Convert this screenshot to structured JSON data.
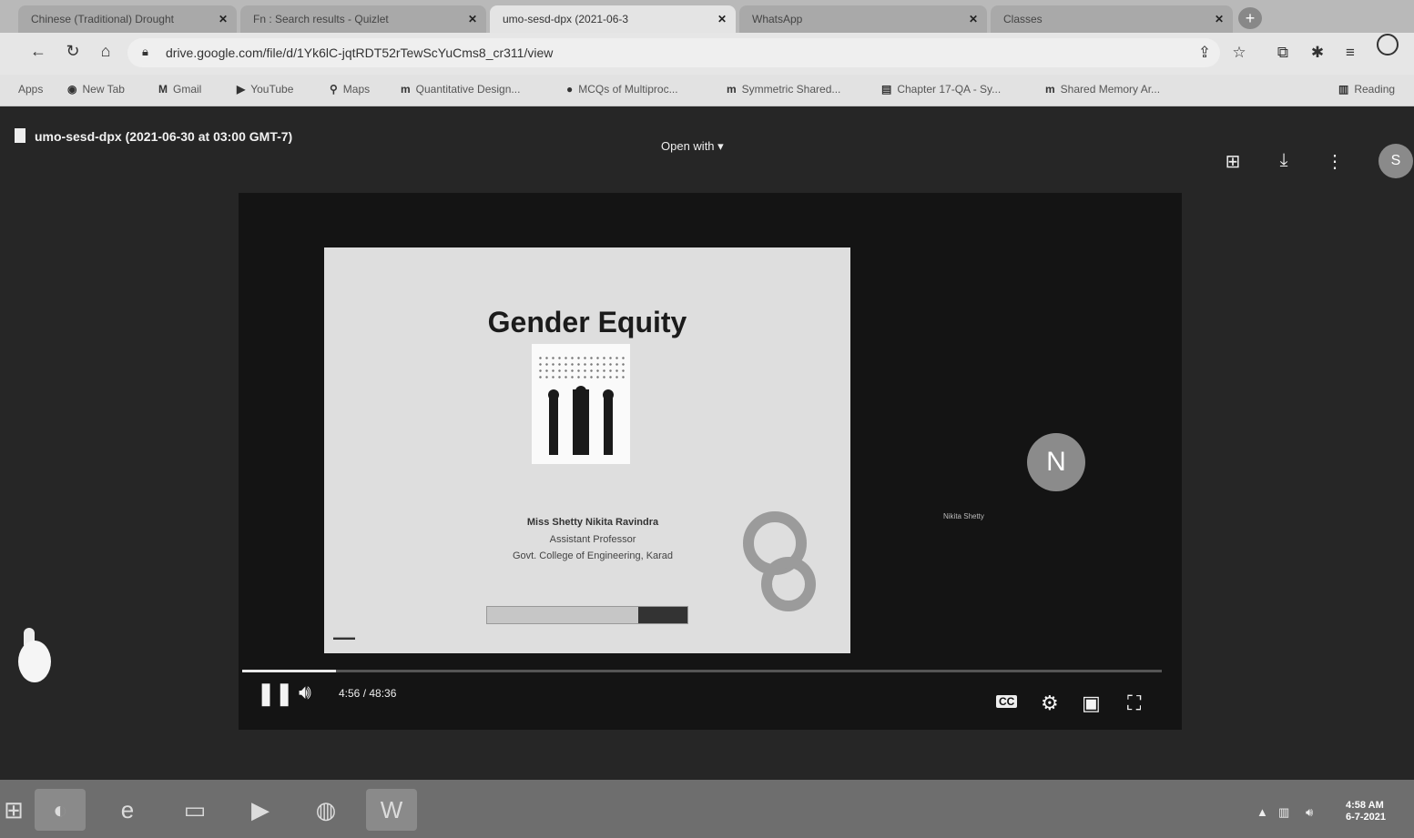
{
  "browser": {
    "tabs": [
      {
        "label": "Chinese (Traditional) Drought"
      },
      {
        "label": "Fn : Search results - Quizlet"
      },
      {
        "label": "umo-sesd-dpx (2021-06-3"
      },
      {
        "label": "WhatsApp"
      },
      {
        "label": "Classes"
      }
    ],
    "url": "drive.google.com/file/d/1Yk6lC-jqtRDT52rTewScYuCms8_cr311/view",
    "bookmarks": [
      {
        "label": "Apps",
        "icon": "apps-grid-icon"
      },
      {
        "label": "New Tab",
        "icon": "new-tab-icon"
      },
      {
        "label": "Gmail",
        "icon": "gmail-icon"
      },
      {
        "label": "YouTube",
        "icon": "youtube-icon"
      },
      {
        "label": "Maps",
        "icon": "maps-pin-icon"
      },
      {
        "label": "Quantitative Design...",
        "icon": "bookmark-m-icon"
      },
      {
        "label": "MCQs of Multiproc...",
        "icon": "bookmark-circle-icon"
      },
      {
        "label": "Symmetric Shared...",
        "icon": "bookmark-m-icon"
      },
      {
        "label": "Chapter 17-QA - Sy...",
        "icon": "bookmark-doc-icon"
      },
      {
        "label": "Shared Memory Ar...",
        "icon": "bookmark-m-icon"
      },
      {
        "label": "Reading",
        "icon": "reading-list-icon"
      }
    ]
  },
  "viewer": {
    "file_title": "umo-sesd-dpx (2021-06-30 at 03:00 GMT-7)",
    "open_with": "Open with",
    "account_initial": "S"
  },
  "slide": {
    "title": "Gender Equity",
    "presenter": "Miss Shetty Nikita Ravindra",
    "role": "Assistant Professor",
    "institution": "Govt. College of Engineering, Karad"
  },
  "participant": {
    "initial": "N",
    "name": "Nikita Shetty"
  },
  "player": {
    "time": "4:56 / 48:36",
    "progress_fraction": 0.102
  },
  "taskbar": {
    "clock_time": "4:58 AM",
    "clock_date": "6-7-2021"
  }
}
